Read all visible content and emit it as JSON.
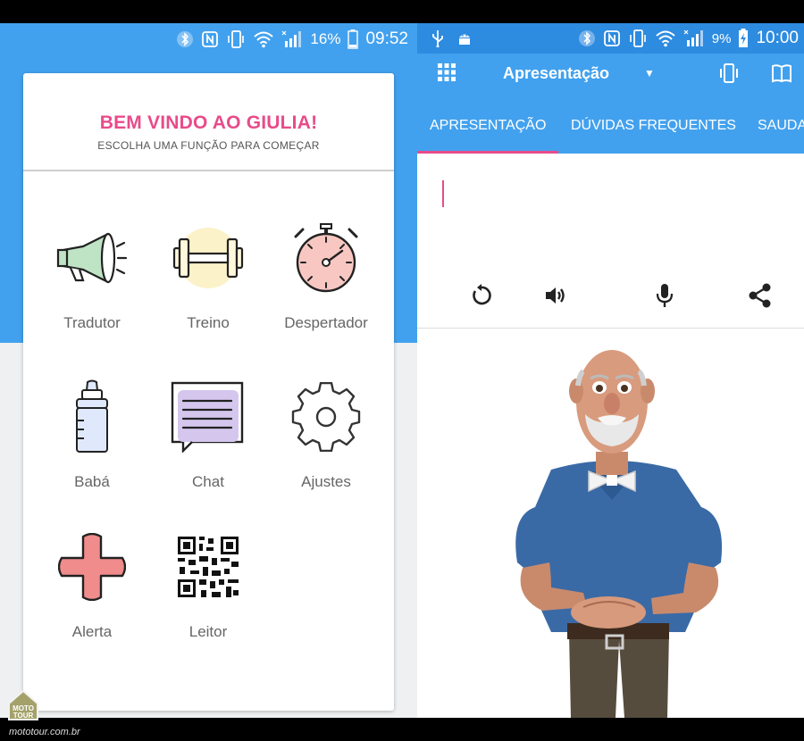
{
  "left_phone": {
    "status": {
      "battery": "16%",
      "time": "09:52"
    },
    "card": {
      "title": "BEM VINDO AO GIULIA!",
      "subtitle": "ESCOLHA UMA FUNÇÃO PARA COMEÇAR"
    },
    "tiles": [
      {
        "label": "Tradutor",
        "icon": "megaphone-icon"
      },
      {
        "label": "Treino",
        "icon": "dumbbell-icon"
      },
      {
        "label": "Despertador",
        "icon": "alarm-clock-icon"
      },
      {
        "label": "Babá",
        "icon": "baby-bottle-icon"
      },
      {
        "label": "Chat",
        "icon": "chat-bubble-icon"
      },
      {
        "label": "Ajustes",
        "icon": "gear-icon"
      },
      {
        "label": "Alerta",
        "icon": "red-cross-icon"
      },
      {
        "label": "Leitor",
        "icon": "qr-code-icon"
      }
    ]
  },
  "right_phone": {
    "status": {
      "battery": "9%",
      "time": "10:00"
    },
    "appbar": {
      "title": "Apresentação"
    },
    "tabs": [
      "APRESENTAÇÃO",
      "DÚVIDAS FREQUENTES",
      "SAUDA"
    ],
    "actions": [
      "replay-icon",
      "volume-icon",
      "microphone-icon",
      "share-icon"
    ]
  },
  "watermark": {
    "brand_line1": "MOTO",
    "brand_line2": "TOUR",
    "url": "mototour.com.br"
  },
  "colors": {
    "primary": "#42a1ee",
    "accent": "#e84b8a"
  }
}
